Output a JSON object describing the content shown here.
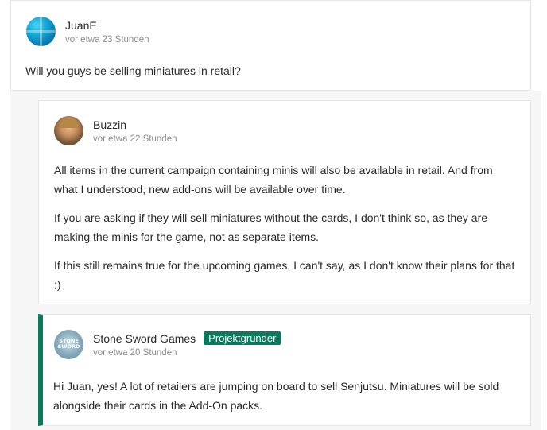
{
  "comment": {
    "author": "JuanE",
    "time": "vor etwa 23 Stunden",
    "avatar_icon": "blue-sphere-avatar",
    "text": "Will you guys be selling miniatures in retail?"
  },
  "replies": [
    {
      "author": "Buzzin",
      "time": "vor etwa 22 Stunden",
      "avatar_icon": "user-photo-avatar",
      "paragraphs": [
        "All items in the current campaign containing minis will also be available in retail. And from what I understood, new add-ons will be available over time.",
        "If you are asking if they will sell miniatures without the cards, I don't think so, as they are making the minis for the game, not as separate items.",
        "If this still remains true for the upcoming games, I can't say, as I don't know their plans for that :)"
      ]
    },
    {
      "author": "Stone Sword Games",
      "badge": "Projektgründer",
      "time": "vor etwa 20 Stunden",
      "avatar_icon": "stone-sword-logo-avatar",
      "avatar_text": "STONE SWORD",
      "accent_color": "#0b7a5c",
      "paragraphs": [
        "Hi Juan, yes! A lot of retailers are jumping on board to sell Senjutsu. Miniatures will be sold alongside their cards in the Add-On packs."
      ]
    }
  ]
}
